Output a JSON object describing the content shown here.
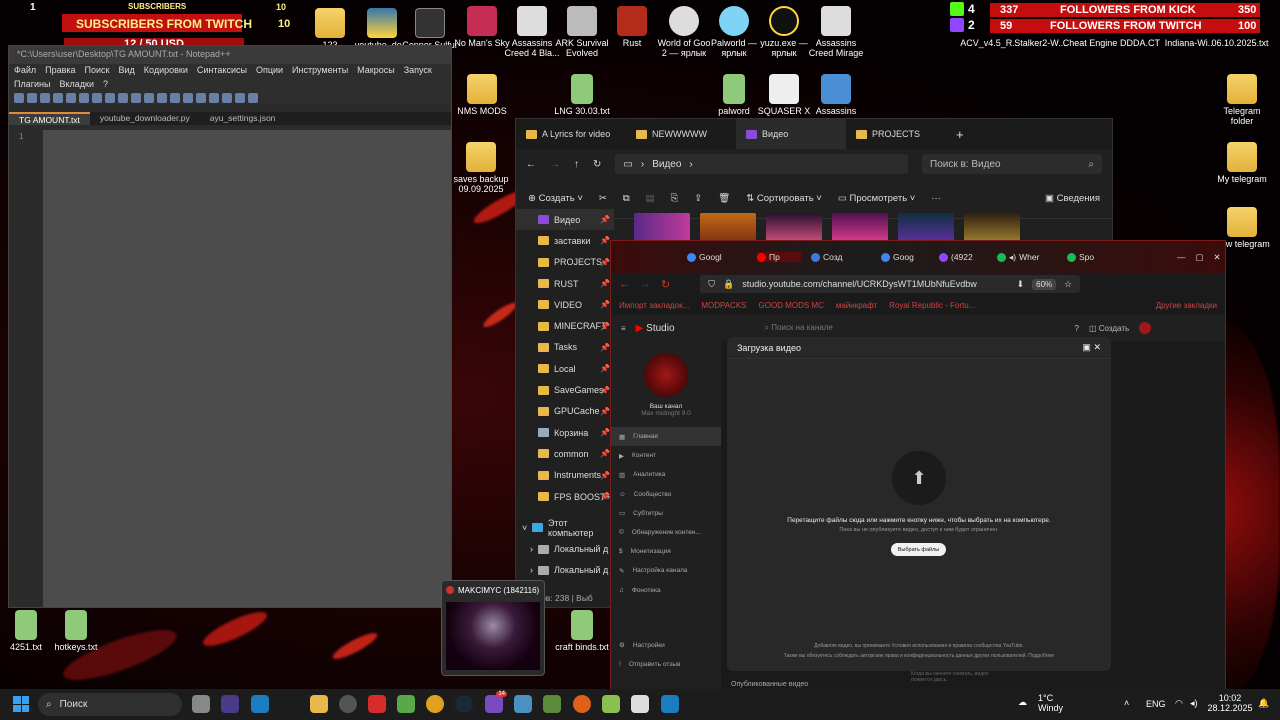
{
  "overlay": {
    "subs_twitch": {
      "count_left": "1",
      "label": "SUBSCRIBERS FROM TWITCH",
      "count_mid": "10",
      "count_right": "10"
    },
    "subs_small": {
      "label": "SUBSCRIBERS",
      "count": "10"
    },
    "donations": {
      "label": "12 / 50 USD"
    },
    "kick": {
      "platform_num": "4",
      "count": "337",
      "label": "FOLLOWERS FROM KICK",
      "goal": "350"
    },
    "twitch": {
      "platform_num": "2",
      "count": "59",
      "label": "FOLLOWERS FROM TWITCH",
      "goal": "100"
    },
    "left_cut": "Корзина"
  },
  "desktop_icons": [
    {
      "label": "No Man's Sky"
    },
    {
      "label": "Assassins Creed 4 Bla..."
    },
    {
      "label": "ARK Survival Evolved"
    },
    {
      "label": "Rust"
    },
    {
      "label": "World of Goo 2 — ярлык"
    },
    {
      "label": "Palworld — ярлык"
    },
    {
      "label": "yuzu.exe — ярлык"
    },
    {
      "label": "Assassins Creed Mirage"
    },
    {
      "label": "ACV_v4.5_R..."
    },
    {
      "label": "Stalker2-W..."
    },
    {
      "label": "Cheat Engine"
    },
    {
      "label": "DDDA.CT"
    },
    {
      "label": "Indiana-Wi..."
    },
    {
      "label": "06.10.2025.txt"
    },
    {
      "label": "NMS MODS"
    },
    {
      "label": "LNG 30.03.txt"
    },
    {
      "label": "palword"
    },
    {
      "label": "SQUASER X"
    },
    {
      "label": "Assassins"
    },
    {
      "label": "Telegram folder"
    },
    {
      "label": "My telegram"
    },
    {
      "label": "New telegram"
    },
    {
      "label": "saves backup 09.09.2025"
    },
    {
      "label": "4251.txt"
    },
    {
      "label": "hotkeys.txt"
    },
    {
      "label": "craft binds.txt"
    },
    {
      "label": "123"
    },
    {
      "label": "youtube_do..."
    },
    {
      "label": "Copper Sulfur"
    }
  ],
  "npp": {
    "title": "*C:\\Users\\user\\Desktop\\TG AMOUNT.txt - Notepad++",
    "menu": [
      "Файл",
      "Правка",
      "Поиск",
      "Вид",
      "Кодировки",
      "Синтаксисы",
      "Опции",
      "Инструменты",
      "Макросы",
      "Запуск",
      "Плагины",
      "Вкладки",
      "?"
    ],
    "tabs": [
      "TG AMOUNT.txt",
      "youtube_downloader.py",
      "ayu_settings.json"
    ],
    "line": "1"
  },
  "explorer": {
    "tabs": [
      "A Lyrics for video",
      "NEWWWWW",
      "Видео",
      "PROJECTS"
    ],
    "crumb": "Видео",
    "search": "Поиск в: Видео",
    "commands": {
      "create": "Создать",
      "sort": "Сортировать",
      "view": "Просмотреть",
      "details": "Сведения"
    },
    "sidebar": [
      "Видео",
      "заставки",
      "PROJECTS",
      "RUST",
      "VIDEO",
      "MINECRAFT",
      "Tasks",
      "Local",
      "SaveGames",
      "GPUCache",
      "Корзина",
      "common",
      "Instruments",
      "FPS BOOST+"
    ],
    "tree": [
      "Этот компьютер",
      "Локальный д",
      "Локальный д"
    ],
    "status": "ментов: 238",
    "status_right": "Выб"
  },
  "browser": {
    "tabs": [
      "Googl",
      "Пр",
      "Созд",
      "Goog",
      "(4922",
      "Wher",
      "Spo"
    ],
    "url": "studio.youtube.com/channel/UCRKDysWT1MUbNfuEvdbw",
    "zoom": "60%",
    "bookmarks": [
      "Импорт закладок...",
      "MODPACKS",
      "GOOD MODS MC",
      "майнкрафт",
      "Royal Republic - Fortu..."
    ],
    "bookmarks_right": "Другие закладки",
    "studio": "Studio",
    "yt_search": "Поиск на канале",
    "create": "Создать",
    "channel_name": "Ваш канал",
    "channel_sub": "Max midnight 9.0",
    "nav": [
      "Главная",
      "Контент",
      "Аналитика",
      "Сообщество",
      "Субтитры",
      "Обнаружение контен...",
      "Монетизация",
      "Настройка канала",
      "Фонотека"
    ],
    "nav_bottom": [
      "Настройки",
      "Отправить отзыв"
    ],
    "dialog_title": "Загрузка видео",
    "dialog_main": "Перетащите файлы сюда или нажмите кнопку ниже, чтобы выбрать их на компьютере.",
    "dialog_sub": "Пока вы не опубликуете видео, доступ к ним будет ограничен.",
    "select_btn": "Выбрать файлы",
    "terms1": "Добавляя видео, вы принимаете Условия использования и правила сообщества YouTube.",
    "terms2": "Также вы обязуетесь соблюдать авторские права и конфиденциальность данных других пользователей. Подробнее",
    "published": "Опубликованные видео",
    "bottom_note": "Когда вы начнете снимать, видео появятся здесь."
  },
  "preview": {
    "title": "MAKCIMYC (1842116)"
  },
  "taskbar": {
    "search": "Поиск",
    "weather_temp": "1°C",
    "weather_desc": "Windy",
    "lang": "ENG",
    "time": "10:02",
    "date": "28.12.2025",
    "badge": "14"
  }
}
